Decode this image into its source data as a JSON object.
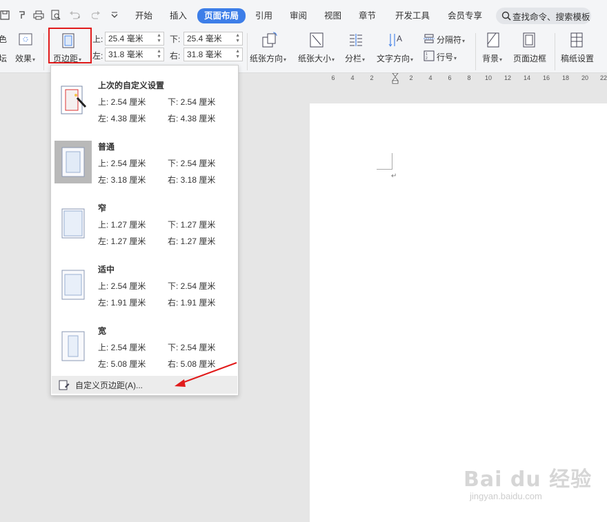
{
  "quick_access": [
    "save-icon",
    "format-painter-icon",
    "print-icon",
    "print-preview-icon",
    "undo-icon",
    "redo-icon",
    "more-icon"
  ],
  "tabs": [
    {
      "label": "开始"
    },
    {
      "label": "插入"
    },
    {
      "label": "页面布局",
      "active": true
    },
    {
      "label": "引用"
    },
    {
      "label": "审阅"
    },
    {
      "label": "视图"
    },
    {
      "label": "章节"
    },
    {
      "label": "开发工具"
    },
    {
      "label": "会员专享"
    }
  ],
  "search": {
    "label": "查找命令、搜索模板"
  },
  "ribbon": {
    "left_partial_top": "色",
    "left_partial_bottom": "坛",
    "effects": "效果",
    "margins": "页边距",
    "top_label": "上:",
    "top_value": "25.4 毫米",
    "bottom_label": "下:",
    "bottom_value": "25.4 毫米",
    "left_label": "左:",
    "left_value": "31.8 毫米",
    "right_label": "右:",
    "right_value": "31.8 毫米",
    "orientation": "纸张方向",
    "size": "纸张大小",
    "columns": "分栏",
    "text_direction": "文字方向",
    "breaks": "分隔符",
    "line_numbers": "行号",
    "background": "背景",
    "page_border": "页面边框",
    "manuscript": "稿纸设置"
  },
  "ruler": {
    "ticks": [
      "6",
      "4",
      "2",
      "2",
      "4",
      "6",
      "8",
      "10",
      "12",
      "14",
      "16",
      "18",
      "20",
      "22"
    ]
  },
  "margin_presets": [
    {
      "title": "上次的自定义设置",
      "top": "上: 2.54 厘米",
      "bottom": "下: 2.54 厘米",
      "left": "左: 4.38 厘米",
      "right": "右: 4.38 厘米",
      "selected": false
    },
    {
      "title": "普通",
      "top": "上: 2.54 厘米",
      "bottom": "下: 2.54 厘米",
      "left": "左: 3.18 厘米",
      "right": "右: 3.18 厘米",
      "selected": true
    },
    {
      "title": "窄",
      "top": "上: 1.27 厘米",
      "bottom": "下: 1.27 厘米",
      "left": "左: 1.27 厘米",
      "right": "右: 1.27 厘米",
      "selected": false
    },
    {
      "title": "适中",
      "top": "上: 2.54 厘米",
      "bottom": "下: 2.54 厘米",
      "left": "左: 1.91 厘米",
      "right": "右: 1.91 厘米",
      "selected": false
    },
    {
      "title": "宽",
      "top": "上: 2.54 厘米",
      "bottom": "下: 2.54 厘米",
      "left": "左: 5.08 厘米",
      "right": "右: 5.08 厘米",
      "selected": false
    }
  ],
  "custom_margins": "自定义页边距(A)...",
  "watermark": {
    "logo": "Bai du 经验",
    "url": "jingyan.baidu.com"
  },
  "colors": {
    "accent": "#3d7ee8",
    "annotation_red": "#e11b1b",
    "ribbon_bg": "#f4f5f7",
    "canvas_bg": "#e6e6e6"
  }
}
